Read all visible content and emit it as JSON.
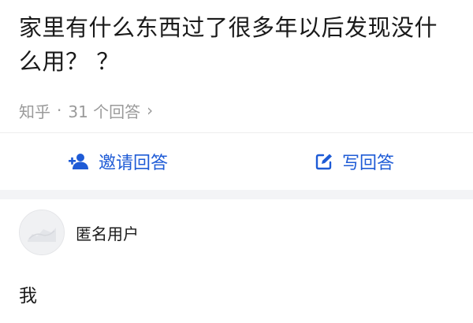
{
  "question": {
    "title": "家里有什么东西过了很多年以后发现没什么用？ ？"
  },
  "meta": {
    "source": "知乎",
    "separator": "·",
    "answer_count": "31 个回答",
    "chevron": "›"
  },
  "actions": {
    "invite_label": "邀请回答",
    "invite_icon": "add-user-icon",
    "write_label": "写回答",
    "write_icon": "edit-icon",
    "accent_color": "#1e5bd6"
  },
  "answer": {
    "author": "匿名用户",
    "avatar_icon": "anonymous-avatar-icon",
    "content": "我"
  }
}
